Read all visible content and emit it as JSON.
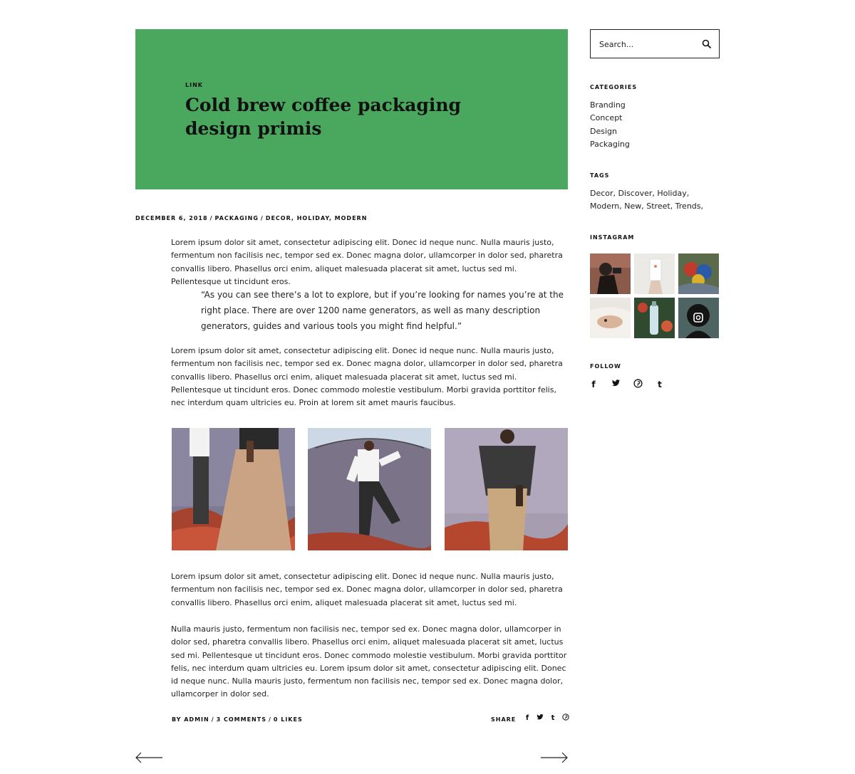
{
  "post": {
    "category_kicker": "LINK",
    "title": "Cold brew coffee packaging design primis",
    "hero_color": "#4aa85e",
    "meta": {
      "date": "DECEMBER 6, 2018",
      "category": "PACKAGING",
      "tags": [
        "DECOR",
        "HOLIDAY",
        "MODERN"
      ]
    },
    "paragraph_1": "Lorem ipsum dolor sit amet, consectetur adipiscing elit. Donec id neque nunc. Nulla mauris justo, fermentum non facilisis nec, tempor sed ex. Donec magna dolor, ullamcorper in dolor sed, pharetra convallis libero. Phasellus orci enim, aliquet malesuada placerat sit amet, luctus sed mi. Pellentesque ut tincidunt eros.",
    "quote": "“As you can see there’s a lot to explore, but if you’re looking for names you’re at the right place. There are over 1200 name generators, as well as many description generators, guides and various tools you might find helpful.”",
    "paragraph_2": "Lorem ipsum dolor sit amet, consectetur adipiscing elit. Donec id neque nunc. Nulla mauris justo, fermentum non facilisis nec, tempor sed ex. Donec magna dolor, ullamcorper in dolor sed, pharetra convallis libero. Phasellus orci enim, aliquet malesuada placerat sit amet, luctus sed mi. Pellentesque ut tincidunt eros. Donec commodo molestie vestibulum. Morbi gravida porttitor felis, nec interdum quam ultricies eu. Proin at lorem sit amet mauris faucibus.",
    "paragraph_3": "Lorem ipsum dolor sit amet, consectetur adipiscing elit. Donec id neque nunc. Nulla mauris justo, fermentum non facilisis nec, tempor sed ex. Donec magna dolor, ullamcorper in dolor sed, pharetra convallis libero. Phasellus orci enim, aliquet malesuada placerat sit amet, luctus sed mi.",
    "paragraph_4": "Nulla mauris justo, fermentum non facilisis nec, tempor sed ex. Donec magna dolor, ullamcorper in dolor sed, pharetra convallis libero. Phasellus orci enim, aliquet malesuada placerat sit amet, luctus sed mi. Pellentesque ut tincidunt eros. Donec commodo molestie vestibulum. Morbi gravida porttitor felis, nec interdum quam ultricies eu. Lorem ipsum dolor sit amet, consectetur adipiscing elit. Donec id neque nunc. Nulla mauris justo, fermentum non facilisis nec, tempor sed ex. Donec magna dolor, ullamcorper in dolor sed.",
    "footer": {
      "author": "BY ADMIN",
      "comments": "3 COMMENTS",
      "likes": "0 LIKES",
      "share_label": "SHARE",
      "share_icons": [
        "facebook-icon",
        "twitter-icon",
        "tumblr-icon",
        "pinterest-icon"
      ]
    },
    "nav": {
      "prev_icon": "arrow-left-icon",
      "next_icon": "arrow-right-icon"
    }
  },
  "sidebar": {
    "search": {
      "placeholder": "Search...",
      "icon": "search-icon"
    },
    "categories_heading": "CATEGORIES",
    "categories": [
      "Branding",
      "Concept",
      "Design",
      "Packaging"
    ],
    "tags_heading": "TAGS",
    "tags_text": "Decor, Discover, Holiday, Modern, New, Street, Trends,",
    "instagram_heading": "INSTAGRAM",
    "follow_heading": "FOLLOW",
    "follow_icons": [
      "facebook-icon",
      "twitter-icon",
      "pinterest-icon",
      "tumblr-icon"
    ]
  }
}
